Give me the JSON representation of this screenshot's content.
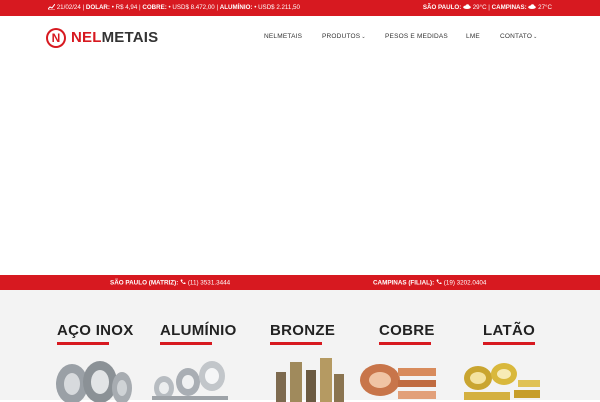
{
  "topbar": {
    "date": "21/02/24",
    "dolar_label": "DOLAR:",
    "dolar_value": "R$ 4,94",
    "cobre_label": "COBRE:",
    "cobre_value": "USD$ 8.472,00",
    "aluminio_label": "ALUMÍNIO:",
    "aluminio_value": "USD$ 2.211,50",
    "sp_label": "SÃO PAULO:",
    "sp_temp": "29°C",
    "campinas_label": "CAMPINAS:",
    "campinas_temp": "27°C",
    "separator": "|"
  },
  "brand": {
    "nel": "NEL",
    "metais": "METAIS",
    "mark_letter": "N"
  },
  "nav": {
    "items": [
      {
        "label": "NELMETAIS"
      },
      {
        "label": "PRODUTOS"
      },
      {
        "label": "PESOS E MEDIDAS"
      },
      {
        "label": "LME"
      },
      {
        "label": "CONTATO"
      }
    ],
    "chevron": "⌄"
  },
  "phones": {
    "sp_label": "SÃO PAULO (MATRIZ):",
    "sp_number": "(11) 3531.3444",
    "cp_label": "CAMPINAS (FILIAL):",
    "cp_number": "(19) 3202.0404"
  },
  "products": [
    {
      "title": "AÇO INOX"
    },
    {
      "title": "ALUMÍNIO"
    },
    {
      "title": "BRONZE"
    },
    {
      "title": "COBRE"
    },
    {
      "title": "LATÃO"
    }
  ],
  "colors": {
    "brand_red": "#d71920",
    "text_dark": "#222222",
    "section_bg": "#f3f3f3"
  },
  "icons": {
    "chart": "chart-line-icon",
    "weather": "cloud-icon",
    "phone": "phone-icon"
  }
}
